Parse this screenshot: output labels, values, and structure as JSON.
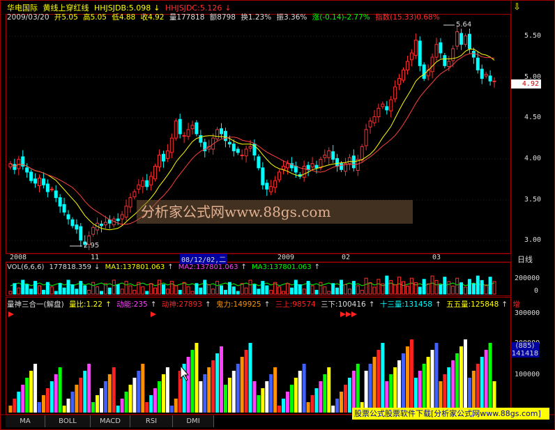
{
  "header": {
    "stock_name": "华电国际",
    "formula": "黄线上穿红线",
    "hhjsjdb": "HHJSJDB:5.098",
    "hhjsjdc": "HHJSJDC:5.126",
    "date": "2009/03/20",
    "open": "开5.05",
    "high": "高5.05",
    "low": "低4.88",
    "close": "收4.92",
    "volume": "量177818",
    "amount": "额8798",
    "turnover": "换1.23%",
    "amplitude": "振3.36%",
    "change": "涨(-0.14)-2.77%",
    "index": "指数(15.33)0.68%"
  },
  "price_axis": [
    "5.50",
    "5.00",
    "4.50",
    "4.00",
    "3.50",
    "3.00"
  ],
  "price_marker": "4.92",
  "price_high_label": "5.64",
  "price_low_label": "2.95",
  "date_axis": [
    "2008",
    "11",
    "08/12/02,二",
    "2009",
    "02",
    "03"
  ],
  "period_label": "日线",
  "vol_header": {
    "label": "VOL(6,6,6)",
    "value": "177818.359",
    "ma1": "MA1:137801.063",
    "ma2": "MA2:137801.063",
    "ma3": "MA3:137801.063"
  },
  "vol_axis": [
    "200000",
    "0"
  ],
  "ind_header": {
    "name": "量神三合一(解盘)",
    "ratio": "量比:1.22",
    "dongneng": "动能:235",
    "dongshen": "动神:27893",
    "guili": "鬼力:149925",
    "sanshang": "三上:98574",
    "sanxia": "三下:100416",
    "shisan": "十三量:131458",
    "wuwu": "五五量:125848",
    "more": "增"
  },
  "ind_axis": [
    "300000",
    "200000",
    "100000"
  ],
  "ind_box1": "(885)",
  "ind_box2": "141418",
  "watermark": "分析家公式网www.88gs.com",
  "ad_bar": "股票公式股票软件下载[分析家公式网www.88gs.com]",
  "tabs": [
    "MA",
    "BOLL",
    "MACD",
    "RSI",
    "DMI"
  ],
  "colors": {
    "up": "#ff3030",
    "down": "#00ffff",
    "ma_yellow": "#ffff00",
    "ma_red": "#ff4040",
    "grid": "#a00000"
  },
  "chart_data": {
    "type": "candlestick",
    "ylim": [
      2.9,
      5.7
    ],
    "closes": [
      3.95,
      3.88,
      4.0,
      3.92,
      3.85,
      3.75,
      3.72,
      3.78,
      3.7,
      3.62,
      3.65,
      3.55,
      3.45,
      3.38,
      3.3,
      3.22,
      3.18,
      3.05,
      3.0,
      3.1,
      3.2,
      3.25,
      3.22,
      3.26,
      3.25,
      3.3,
      3.28,
      3.35,
      3.45,
      3.55,
      3.62,
      3.7,
      3.75,
      3.68,
      3.8,
      3.92,
      4.05,
      3.98,
      4.1,
      4.25,
      4.45,
      4.3,
      4.28,
      4.35,
      4.4,
      4.3,
      4.2,
      4.1,
      4.15,
      4.25,
      4.35,
      4.3,
      4.22,
      4.18,
      4.1,
      4.08,
      4.05,
      4.12,
      4.15,
      4.05,
      3.9,
      3.7,
      3.65,
      3.68,
      3.75,
      3.85,
      3.92,
      3.95,
      3.9,
      3.85,
      3.8,
      3.92,
      3.88,
      3.95,
      3.9,
      4.0,
      4.05,
      4.1,
      4.0,
      3.92,
      3.88,
      3.95,
      4.02,
      3.9,
      4.0,
      4.15,
      4.35,
      4.45,
      4.5,
      4.6,
      4.65,
      4.58,
      4.7,
      4.85,
      4.95,
      5.05,
      5.15,
      5.25,
      5.4,
      5.1,
      4.95,
      5.05,
      5.2,
      5.35,
      5.25,
      5.1,
      5.15,
      5.3,
      5.5,
      5.35,
      5.45,
      5.3,
      5.2,
      5.05,
      4.95,
      5.0,
      4.92,
      4.92
    ]
  }
}
